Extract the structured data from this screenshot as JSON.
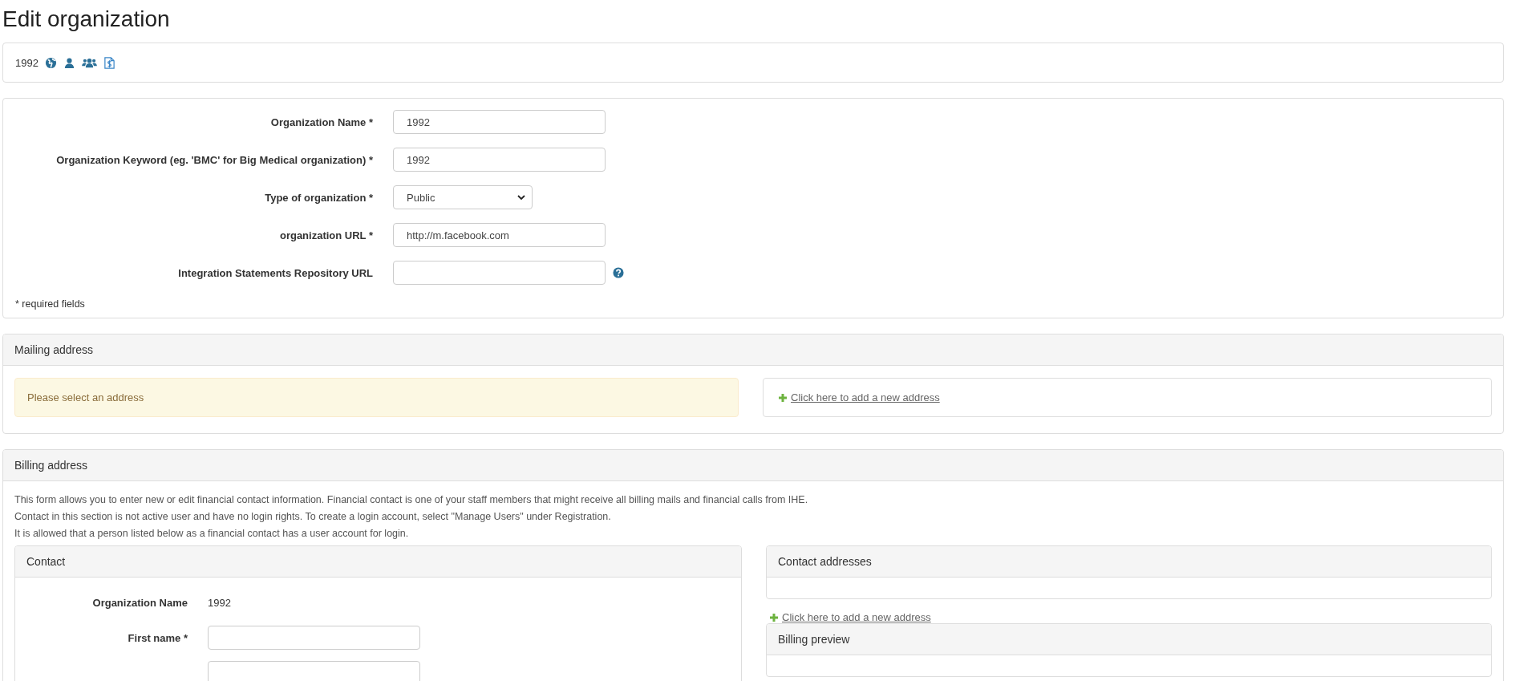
{
  "title": "Edit organization",
  "toolbar": {
    "name": "1992"
  },
  "form": {
    "fields": [
      {
        "label": "Organization Name *",
        "kind": "text",
        "value": "1992",
        "help": false
      },
      {
        "label": "Organization Keyword (eg. 'BMC' for Big Medical organization) *",
        "kind": "text",
        "value": "1992",
        "help": false
      },
      {
        "label": "Type of organization *",
        "kind": "select",
        "value": "Public",
        "help": false
      },
      {
        "label": "organization URL *",
        "kind": "text",
        "value": "http://m.facebook.com",
        "help": false
      },
      {
        "label": "Integration Statements Repository URL",
        "kind": "text",
        "help": true
      }
    ],
    "note": "* required fields"
  },
  "mailing": {
    "title": "Mailing address",
    "alert": "Please select an address",
    "add_link": "Click here to add a new address"
  },
  "billing": {
    "title": "Billing address",
    "info": [
      "This form allows you to enter new or edit financial contact information. Financial contact is one of your staff members that might receive all billing mails and financial calls from IHE.",
      "Contact in this section is not active user and have no login rights. To create a login account, select \"Manage Users\" under Registration.",
      "It is allowed that a person listed below as a financial contact has a user account for login."
    ],
    "contact": {
      "title": "Contact",
      "rows": [
        {
          "label": "Organization Name",
          "kind": "static",
          "value": "1992"
        },
        {
          "label": "First name *",
          "kind": "input"
        },
        {
          "kind": "input"
        }
      ]
    },
    "addresses": {
      "title": "Contact addresses",
      "add_link": "Click here to add a new address"
    },
    "preview": {
      "title": "Billing preview"
    }
  }
}
